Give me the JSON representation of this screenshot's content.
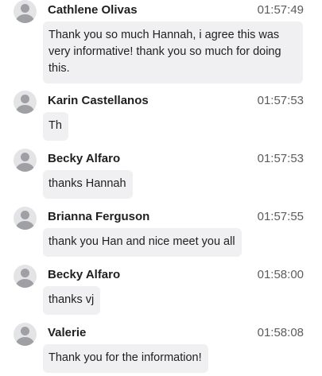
{
  "messages": [
    {
      "sender": "Cathlene Olivas",
      "time": "01:57:49",
      "text": "Thank you so much Hannah, i agree this was very informative! thank you so much for doing this."
    },
    {
      "sender": "Karin Castellanos",
      "time": "01:57:53",
      "text": "Th"
    },
    {
      "sender": "Becky Alfaro",
      "time": "01:57:53",
      "text": "thanks Hannah"
    },
    {
      "sender": "Brianna Ferguson",
      "time": "01:57:55",
      "text": "thank you Han and nice meet you all"
    },
    {
      "sender": "Becky Alfaro",
      "time": "01:58:00",
      "text": "thanks vj"
    },
    {
      "sender": "Valerie",
      "time": "01:58:08",
      "text": "Thank you for the information!"
    }
  ]
}
